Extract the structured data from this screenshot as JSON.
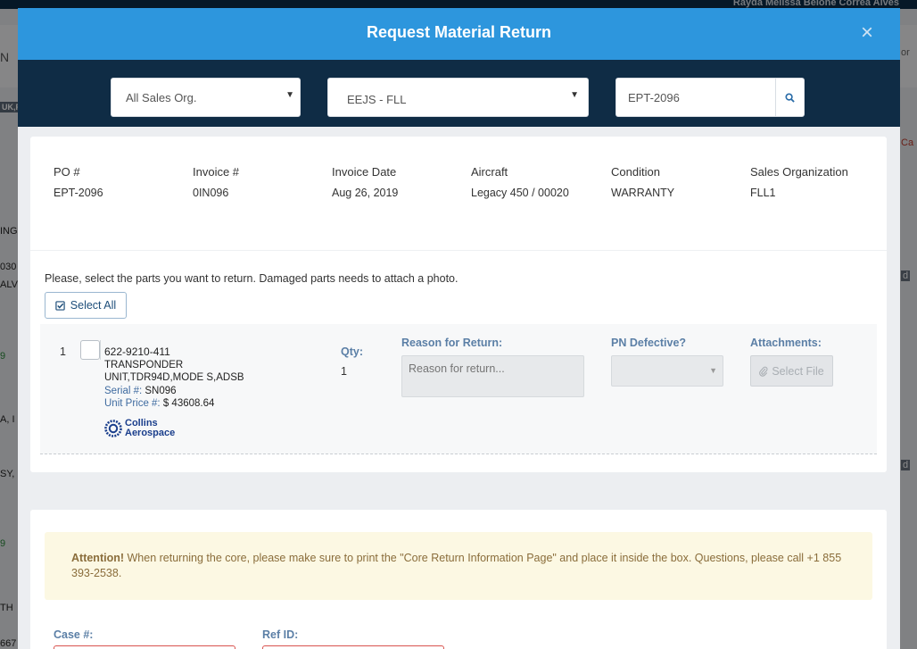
{
  "background": {
    "user_name": "Rayda Melissa Belone Correa Alves",
    "left_fragments": [
      "N",
      "UK,F",
      "ING",
      "030",
      "ALV",
      "9",
      "A, I",
      "SY,",
      "9",
      "TH",
      "667"
    ],
    "right_fragments": [
      "or",
      "Ca",
      "d",
      "d"
    ]
  },
  "modal": {
    "title": "Request Material Return",
    "close_label": "×",
    "filters": {
      "sales_org": "All Sales Org.",
      "location": "EEJS - FLL",
      "search_value": "EPT-2096",
      "search_placeholder": "Search"
    },
    "order_info": [
      {
        "label": "PO #",
        "value": "EPT-2096"
      },
      {
        "label": "Invoice #",
        "value": "0IN096"
      },
      {
        "label": "Invoice Date",
        "value": "Aug 26, 2019"
      },
      {
        "label": "Aircraft",
        "value": "Legacy 450 / 00020"
      },
      {
        "label": "Condition",
        "value": "WARRANTY"
      },
      {
        "label": "Sales Organization",
        "value": "FLL1"
      }
    ],
    "instruction": "Please, select the parts you want to return. Damaged parts needs to attach a photo.",
    "select_all_label": "Select All",
    "part": {
      "index": "1",
      "part_number": "622-9210-411",
      "description": "TRANSPONDER UNIT,TDR94D,MODE S,ADSB",
      "serial_label": "Serial #:",
      "serial_value": "SN096",
      "price_label": "Unit Price #:",
      "price_value": "$ 43608.64",
      "brand_line1": "Collins",
      "brand_line2": "Aerospace",
      "qty_label": "Qty:",
      "qty_value": "1",
      "reason_label": "Reason for Return:",
      "reason_placeholder": "Reason for return...",
      "defective_label": "PN Defective?",
      "attachments_label": "Attachments:",
      "select_file_label": "Select File"
    },
    "alert": {
      "strong": "Attention!",
      "text": " When returning the core, please make sure to print the \"Core Return Information Page\" and place it inside the box. Questions, please call +1 855 393-2538."
    },
    "case_label": "Case #:",
    "ref_label": "Ref ID:"
  },
  "colors": {
    "header_blue": "#2d96dd",
    "filter_navy": "#0f2c45",
    "label_blue": "#5b7fa6",
    "alert_bg": "#fcf8e3",
    "alert_text": "#8a6d3b",
    "error_red": "#d9534f"
  }
}
